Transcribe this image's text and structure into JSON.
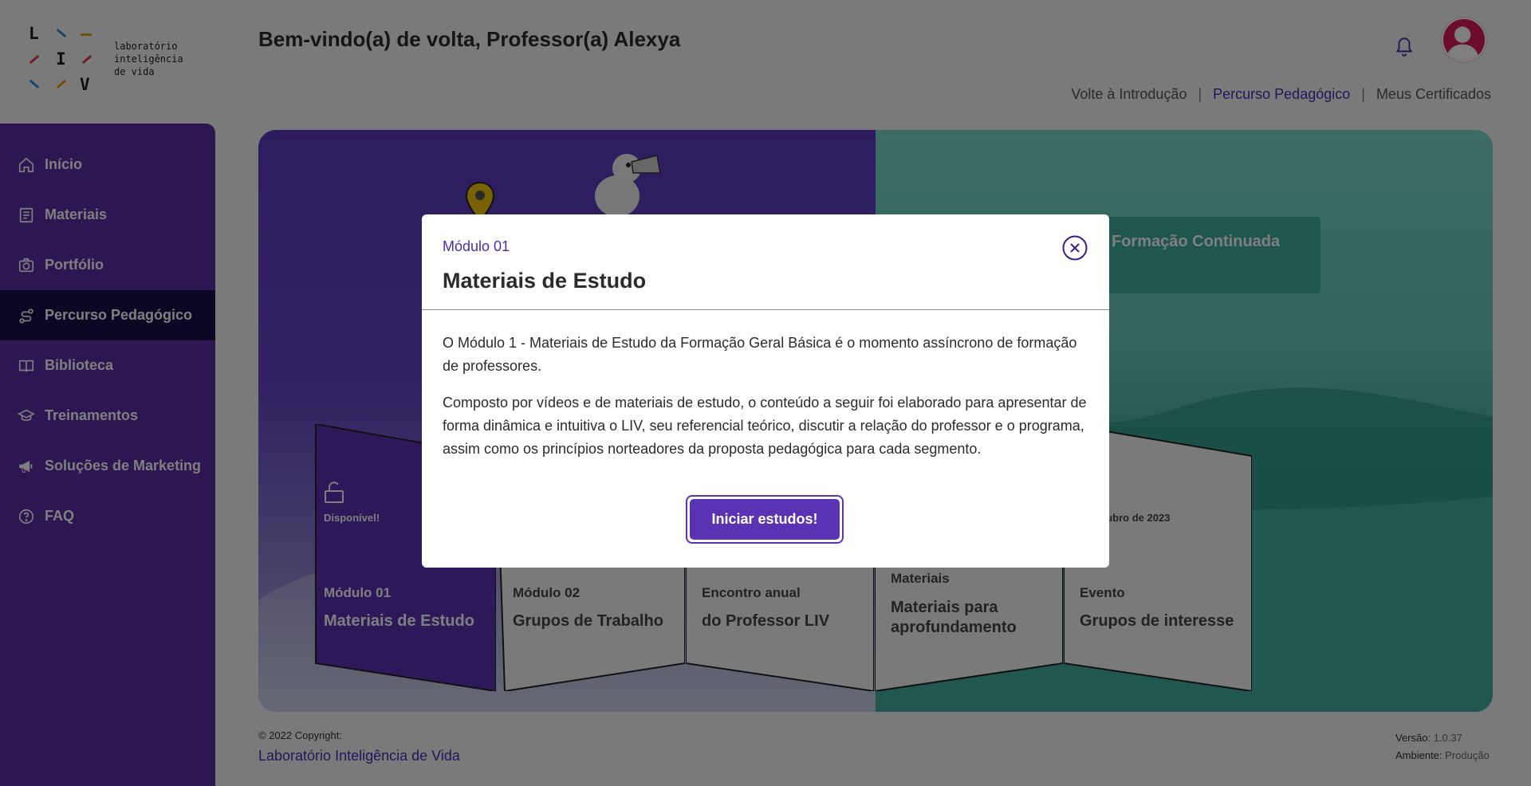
{
  "logo": {
    "letters": [
      "L",
      "I",
      "V"
    ],
    "text_lines": [
      "laboratório",
      "inteligência",
      "de vida"
    ]
  },
  "sidebar": {
    "items": [
      {
        "label": "Início",
        "icon": "home-icon"
      },
      {
        "label": "Materiais",
        "icon": "book-icon"
      },
      {
        "label": "Portfólio",
        "icon": "camera-icon"
      },
      {
        "label": "Percurso Pedagógico",
        "icon": "route-icon",
        "active": true
      },
      {
        "label": "Biblioteca",
        "icon": "open-book-icon"
      },
      {
        "label": "Treinamentos",
        "icon": "graduation-cap-icon"
      },
      {
        "label": "Soluções de Marketing",
        "icon": "megaphone-icon"
      },
      {
        "label": "FAQ",
        "icon": "question-circle-icon"
      }
    ]
  },
  "header": {
    "greeting": "Bem-vindo(a) de volta, Professor(a) Alexya",
    "links": [
      "Volte à Introdução",
      "Percurso Pedagógico",
      "Meus Certificados"
    ],
    "separator": "|"
  },
  "banner": {
    "continued_label": "Formação Continuada",
    "cards": [
      {
        "status": "Disponível!",
        "label": "Módulo 01",
        "title": "Materiais de Estudo"
      },
      {
        "label": "Módulo 02",
        "title": "Grupos de Trabalho"
      },
      {
        "label": "Encontro anual",
        "title": "do Professor LIV"
      },
      {
        "label": "Materiais",
        "title": "Materiais para aprofundamento"
      },
      {
        "status": "a Outubro de 2023",
        "label": "Evento",
        "title": "Grupos de interesse"
      }
    ]
  },
  "footer": {
    "copyright": "© 2022 Copyright:",
    "company": "Laboratório Inteligência de Vida",
    "version_label": "Versão:",
    "version_value": "1.0.37",
    "env_label": "Ambiente:",
    "env_value": "Produção"
  },
  "modal": {
    "kicker": "Módulo 01",
    "title": "Materiais de Estudo",
    "paragraph1": "O Módulo 1 - Materiais de Estudo da Formação Geral Básica é o momento assíncrono de formação de professores.",
    "paragraph2": "Composto por vídeos e de materiais de estudo, o conteúdo a seguir foi elaborado para apresentar de forma dinâmica e intuitiva o LIV, seu referencial teórico, discutir a relação do professor e o programa, assim como os princípios norteadores da proposta pedagógica para cada segmento.",
    "button": "Iniciar estudos!"
  },
  "colors": {
    "primary": "#5a33b5",
    "sidebar": "#5a2fa6",
    "sidebar_active": "#1a0e4a",
    "teal": "#3fae9c",
    "avatar": "#d81b60"
  }
}
